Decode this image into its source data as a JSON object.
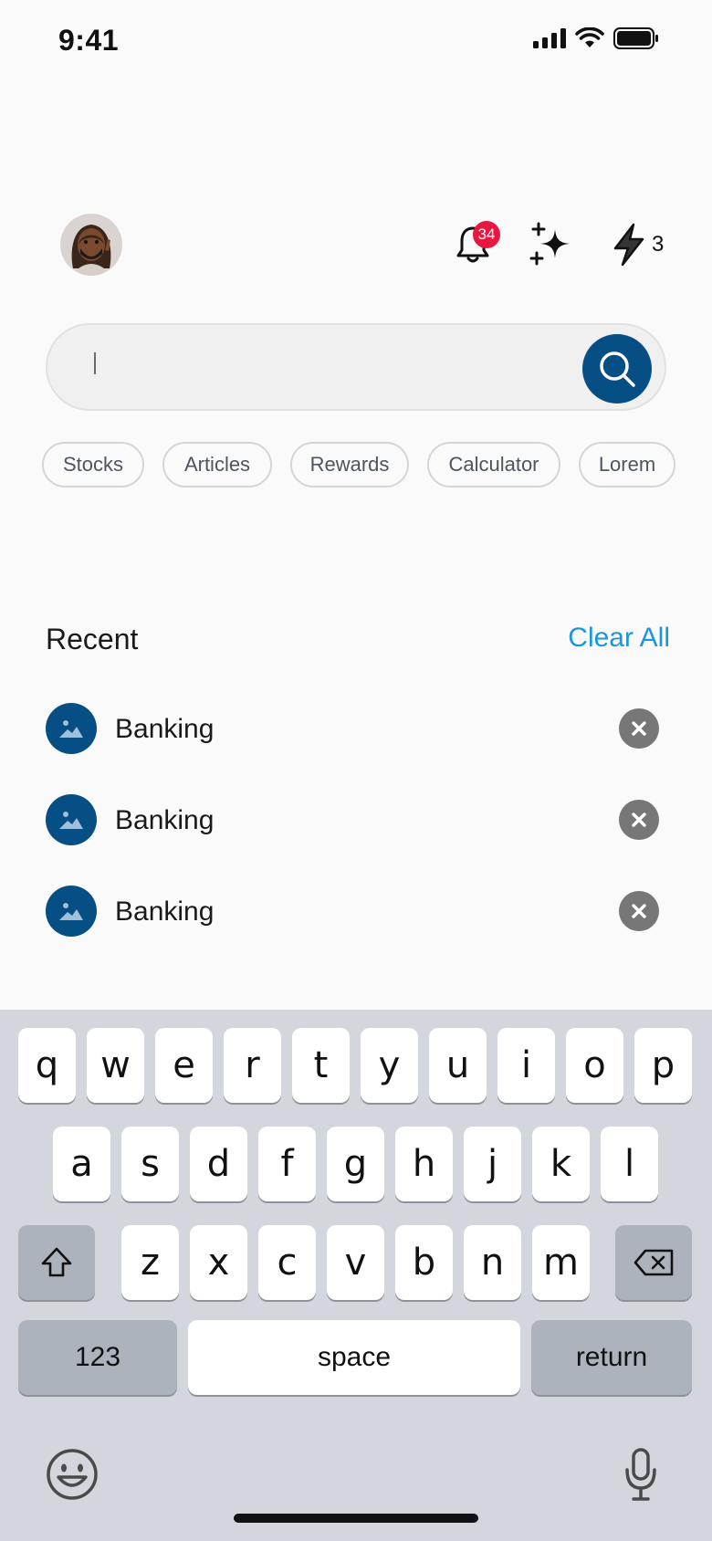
{
  "status_bar": {
    "time": "9:41"
  },
  "header": {
    "notification_count": "34",
    "bolt_count": "3"
  },
  "search": {
    "value": "",
    "placeholder": ""
  },
  "chips": [
    "Stocks",
    "Articles",
    "Rewards",
    "Calculator",
    "Lorem"
  ],
  "recent": {
    "title": "Recent",
    "clear_label": "Clear All",
    "items": [
      {
        "label": "Banking"
      },
      {
        "label": "Banking"
      },
      {
        "label": "Banking"
      }
    ]
  },
  "keyboard": {
    "row1": [
      "q",
      "w",
      "e",
      "r",
      "t",
      "y",
      "u",
      "i",
      "o",
      "p"
    ],
    "row2": [
      "a",
      "s",
      "d",
      "f",
      "g",
      "h",
      "j",
      "k",
      "l"
    ],
    "row3": [
      "z",
      "x",
      "c",
      "v",
      "b",
      "n",
      "m"
    ],
    "numbers_label": "123",
    "space_label": "space",
    "return_label": "return"
  },
  "colors": {
    "accent": "#064f85",
    "link": "#1b95e0",
    "badge": "#e8173f",
    "keyboard_bg": "#d3d6dc"
  }
}
